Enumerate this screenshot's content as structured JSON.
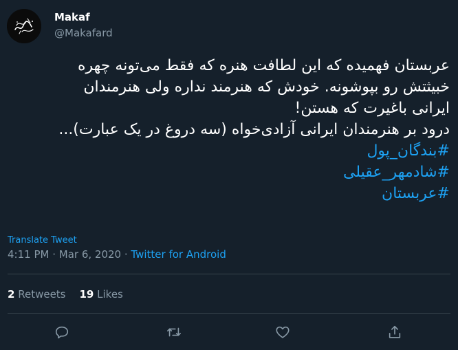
{
  "user": {
    "display_name": "Makaf",
    "handle": "@Makafard"
  },
  "tweet": {
    "lines": [
      "عربستان فهمیده که این لطافت هنره که فقط می‌تونه چهره",
      "خبیثتش رو بپوشونه. خودش که هنرمند نداره ولی هنرمندان",
      "ایرانی باغیرت که هستن!",
      "درود بر هنرمندان ایرانی آزادی‌خواه (سه دروغ در یک عبارت)..."
    ],
    "hashtags": [
      "#بندگان_پول",
      "#شادمهر_عقیلی",
      "#عربستان"
    ]
  },
  "translate_label": "Translate Tweet",
  "meta": {
    "time": "4:11 PM",
    "separator": " · ",
    "date": "Mar 6, 2020",
    "source": "Twitter for Android"
  },
  "stats": {
    "retweets_count": "2",
    "retweets_label": "Retweets",
    "likes_count": "19",
    "likes_label": "Likes"
  },
  "colors": {
    "background": "#15202b",
    "accent": "#1da1f2",
    "secondary_text": "#8899a6",
    "divider": "#38444d"
  },
  "icons": [
    "reply-icon",
    "retweet-icon",
    "like-icon",
    "share-icon"
  ]
}
